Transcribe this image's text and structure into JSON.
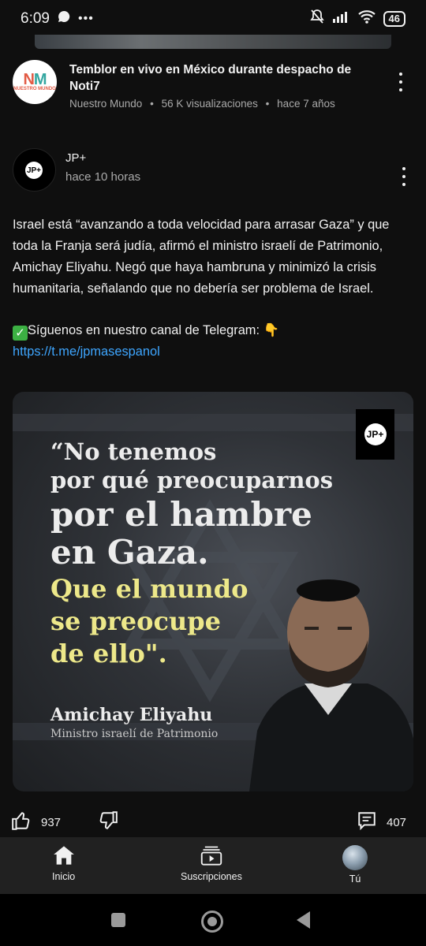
{
  "status_bar": {
    "time": "6:09",
    "battery": "46"
  },
  "video": {
    "title": "Temblor en vivo en México durante despacho de Noti7",
    "channel": "Nuestro Mundo",
    "views": "56 K visualizaciones",
    "age": "hace 7 años",
    "avatar_logo": "NUESTRO MUNDO"
  },
  "post": {
    "channel": "JP+",
    "time": "hace 10 horas",
    "body": "Israel está “avanzando a toda velocidad para arrasar Gaza” y que toda la Franja será judía, afirmó el ministro israelí de Patrimonio, Amichay Eliyahu. Negó que haya hambruna y minimizó la crisis humanitaria, señalando que no debería ser problema de Israel.",
    "telegram_line": "Síguenos en nuestro canal de Telegram: 👇",
    "telegram_link": "https://t.me/jpmasespanol",
    "image": {
      "quote_line1": "“No tenemos",
      "quote_line2": "por qué preocuparnos",
      "quote_line3": "por el hambre",
      "quote_line4": "en Gaza.",
      "quote_line5": "Que el mundo",
      "quote_line6": "se preocupe",
      "quote_line7": "de ello\".",
      "person_name": "Amichay Eliyahu",
      "person_role": "Ministro israelí de Patrimonio",
      "logo": "JP+"
    },
    "likes": "937",
    "comments": "407"
  },
  "bottom_nav": {
    "home": "Inicio",
    "subscriptions": "Suscripciones",
    "you": "Tú"
  },
  "colors": {
    "background": "#0f0f0f",
    "link": "#3ea6ff",
    "quote_highlight": "#ede88a",
    "nav_background": "#212121"
  }
}
